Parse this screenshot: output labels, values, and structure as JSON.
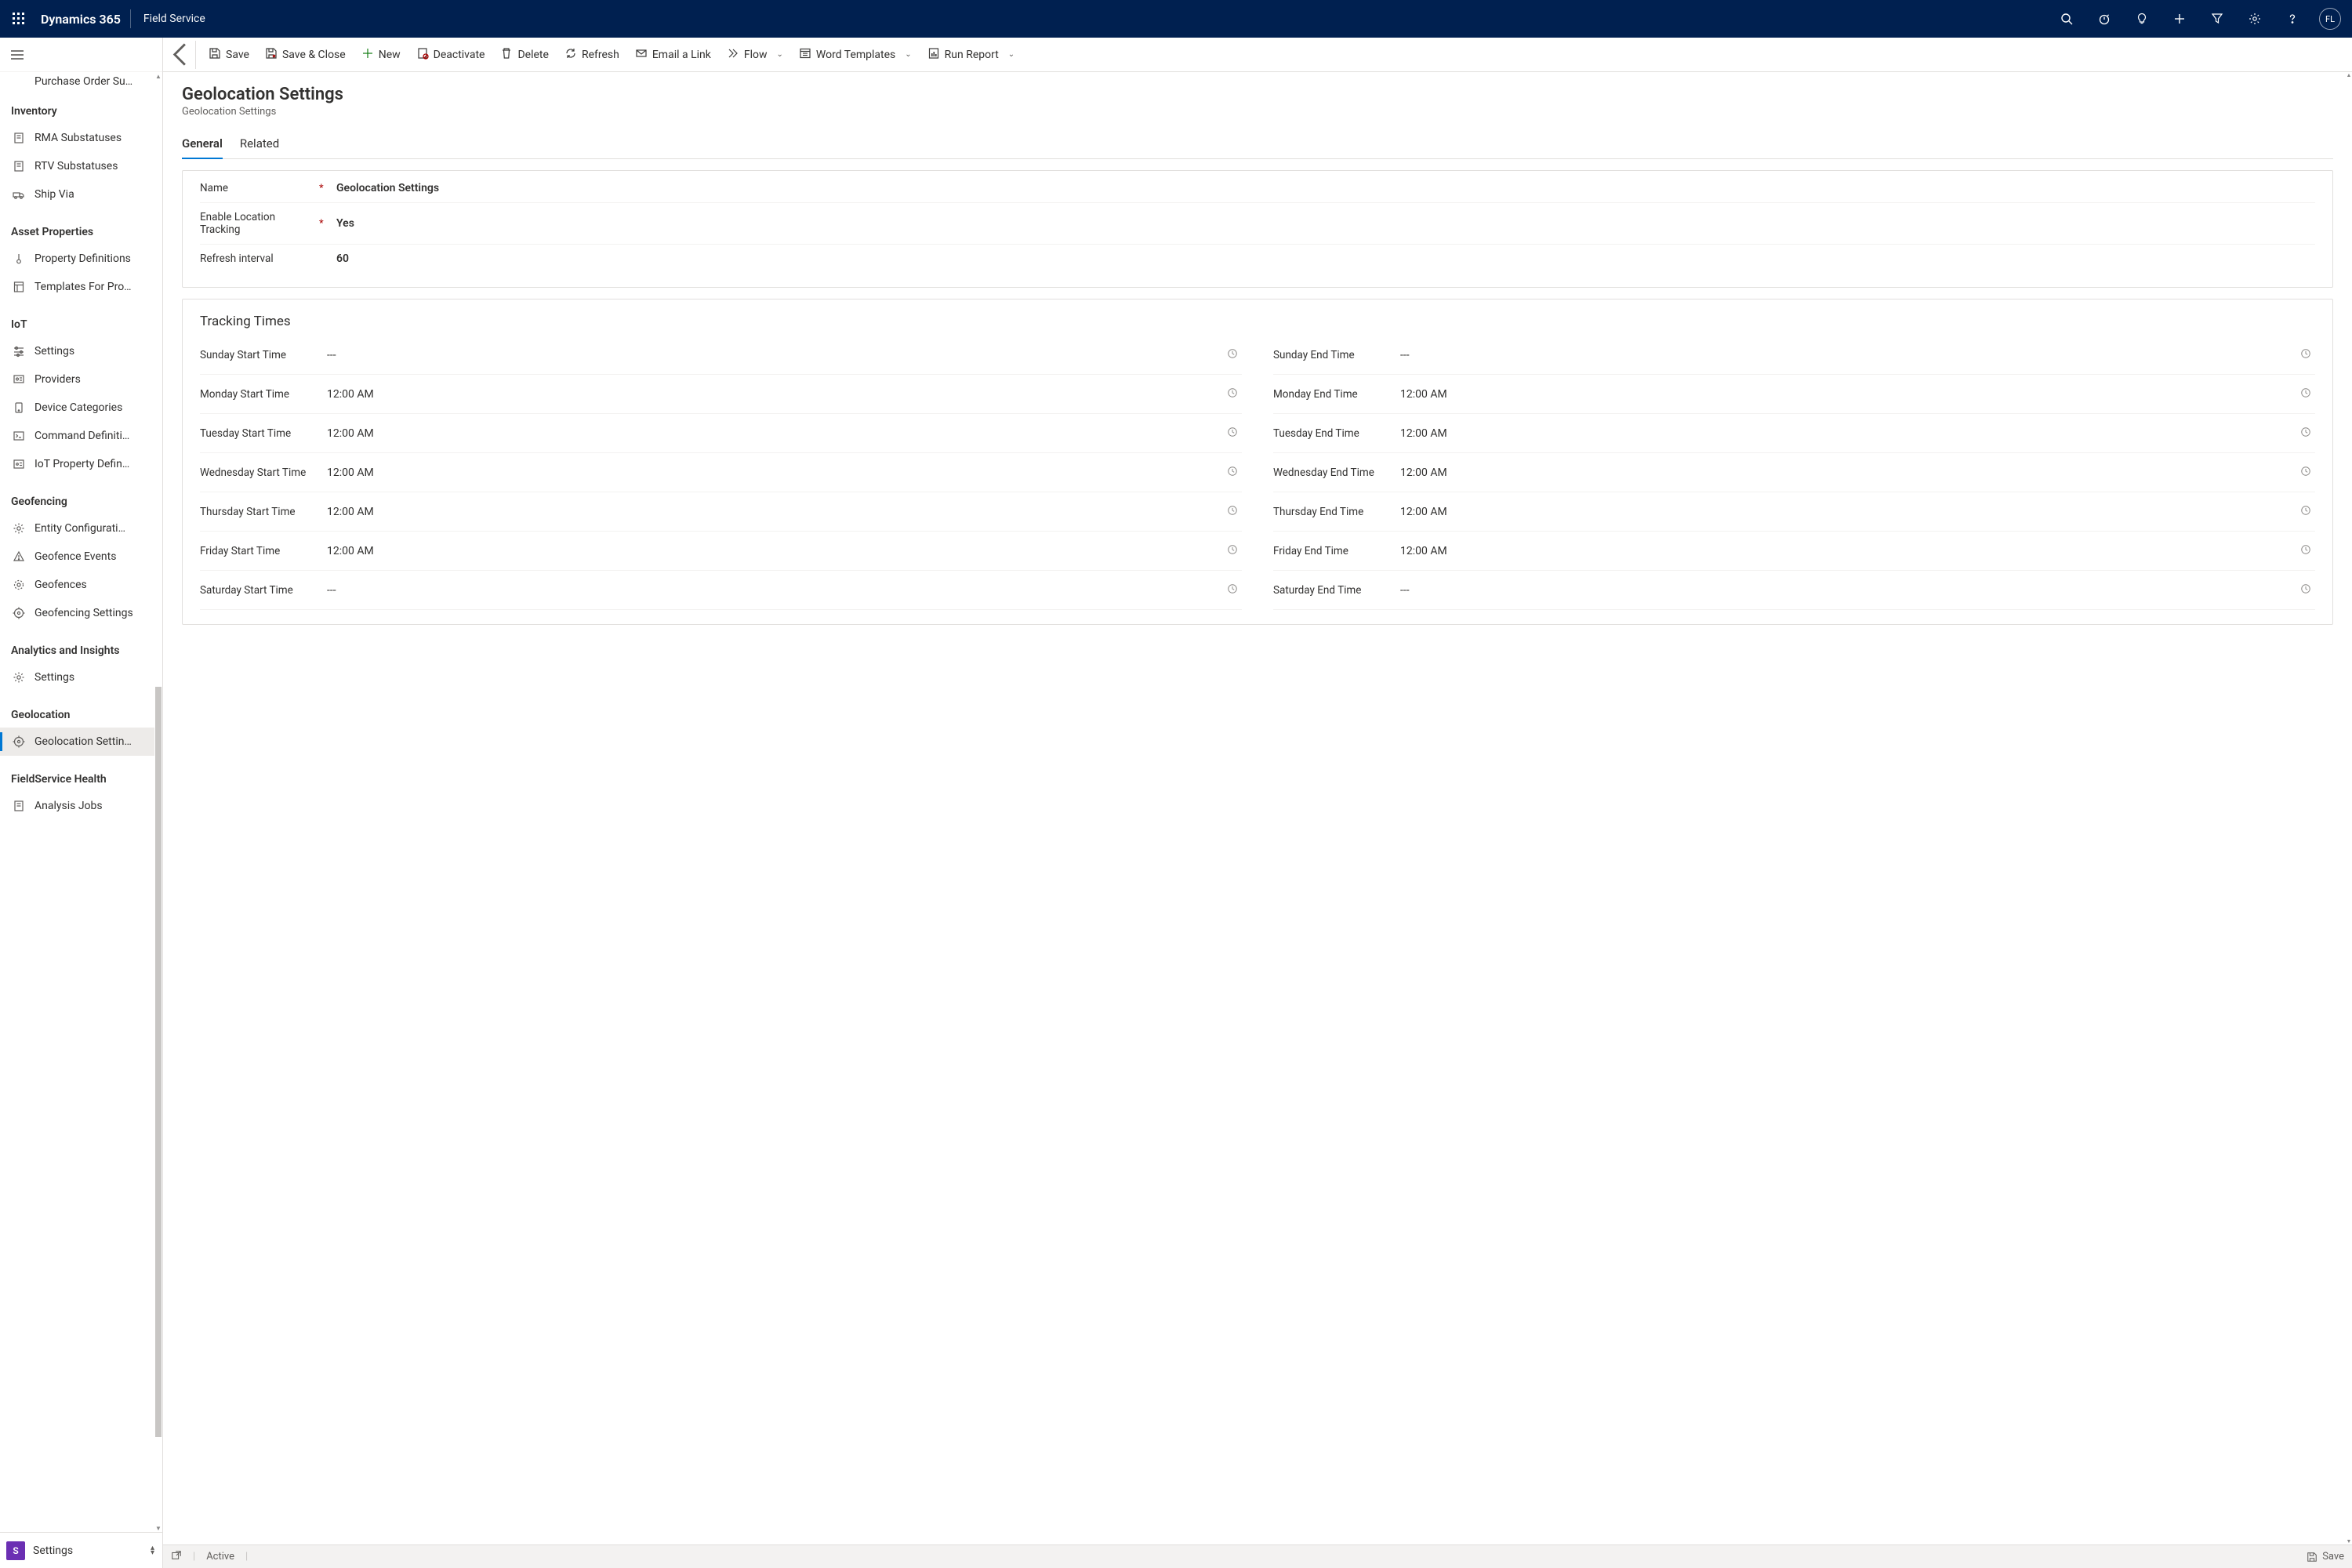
{
  "topbar": {
    "brand": "Dynamics 365",
    "app": "Field Service",
    "avatar_initials": "FL"
  },
  "sidenav": {
    "clipped_item": "Purchase Order Su…",
    "groups": [
      {
        "header": "Inventory",
        "items": [
          {
            "icon": "doc",
            "label": "RMA Substatuses"
          },
          {
            "icon": "doc",
            "label": "RTV Substatuses"
          },
          {
            "icon": "truck",
            "label": "Ship Via"
          }
        ]
      },
      {
        "header": "Asset Properties",
        "items": [
          {
            "icon": "thermo",
            "label": "Property Definitions"
          },
          {
            "icon": "template",
            "label": "Templates For Pro…"
          }
        ]
      },
      {
        "header": "IoT",
        "items": [
          {
            "icon": "sliders",
            "label": "Settings"
          },
          {
            "icon": "providers",
            "label": "Providers"
          },
          {
            "icon": "device",
            "label": "Device Categories"
          },
          {
            "icon": "cmd",
            "label": "Command Definiti…"
          },
          {
            "icon": "iotprop",
            "label": "IoT Property Defin…"
          }
        ]
      },
      {
        "header": "Geofencing",
        "items": [
          {
            "icon": "gear",
            "label": "Entity Configurati…"
          },
          {
            "icon": "warn",
            "label": "Geofence Events"
          },
          {
            "icon": "fence",
            "label": "Geofences"
          },
          {
            "icon": "geo",
            "label": "Geofencing Settings"
          }
        ]
      },
      {
        "header": "Analytics and Insights",
        "items": [
          {
            "icon": "gear",
            "label": "Settings"
          }
        ]
      },
      {
        "header": "Geolocation",
        "items": [
          {
            "icon": "geo",
            "label": "Geolocation Settin…",
            "selected": true
          }
        ]
      },
      {
        "header": "FieldService Health",
        "items": [
          {
            "icon": "doc",
            "label": "Analysis Jobs"
          }
        ]
      }
    ],
    "area": {
      "badge": "S",
      "label": "Settings"
    }
  },
  "commandbar": {
    "items": [
      {
        "icon": "save",
        "label": "Save",
        "chevron": false
      },
      {
        "icon": "saveclose",
        "label": "Save & Close",
        "chevron": false
      },
      {
        "icon": "plus",
        "label": "New",
        "chevron": false,
        "accent": "green"
      },
      {
        "icon": "deactivate",
        "label": "Deactivate",
        "chevron": false
      },
      {
        "icon": "delete",
        "label": "Delete",
        "chevron": false
      },
      {
        "icon": "refresh",
        "label": "Refresh",
        "chevron": false
      },
      {
        "icon": "mail",
        "label": "Email a Link",
        "chevron": false
      },
      {
        "icon": "flow",
        "label": "Flow",
        "chevron": true
      },
      {
        "icon": "word",
        "label": "Word Templates",
        "chevron": true
      },
      {
        "icon": "report",
        "label": "Run Report",
        "chevron": true
      }
    ]
  },
  "record": {
    "title": "Geolocation Settings",
    "subtitle": "Geolocation Settings",
    "tabs": {
      "general": "General",
      "related": "Related"
    },
    "fields": {
      "name": {
        "label": "Name",
        "required": true,
        "value": "Geolocation Settings"
      },
      "enable": {
        "label": "Enable Location Tracking",
        "required": true,
        "value": "Yes"
      },
      "refresh": {
        "label": "Refresh interval",
        "required": false,
        "value": "60"
      }
    },
    "tracking_section_title": "Tracking Times",
    "tracking": {
      "start": [
        {
          "label": "Sunday Start Time",
          "value": "---"
        },
        {
          "label": "Monday Start Time",
          "value": "12:00 AM"
        },
        {
          "label": "Tuesday Start Time",
          "value": "12:00 AM"
        },
        {
          "label": "Wednesday Start Time",
          "value": "12:00 AM"
        },
        {
          "label": "Thursday Start Time",
          "value": "12:00 AM"
        },
        {
          "label": "Friday Start Time",
          "value": "12:00 AM"
        },
        {
          "label": "Saturday Start Time",
          "value": "---"
        }
      ],
      "end": [
        {
          "label": "Sunday End Time",
          "value": "---"
        },
        {
          "label": "Monday End Time",
          "value": "12:00 AM"
        },
        {
          "label": "Tuesday End Time",
          "value": "12:00 AM"
        },
        {
          "label": "Wednesday End Time",
          "value": "12:00 AM"
        },
        {
          "label": "Thursday End Time",
          "value": "12:00 AM"
        },
        {
          "label": "Friday End Time",
          "value": "12:00 AM"
        },
        {
          "label": "Saturday End Time",
          "value": "---"
        }
      ]
    }
  },
  "statusbar": {
    "status": "Active",
    "save": "Save"
  }
}
